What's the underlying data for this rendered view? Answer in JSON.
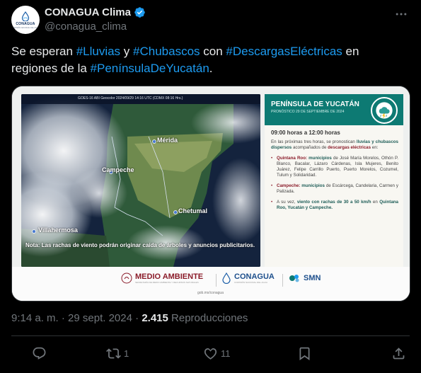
{
  "account": {
    "display_name": "CONAGUA Clima",
    "handle": "@conagua_clima",
    "avatar_text": "CONAGUA",
    "avatar_subtext": "COMISIÓN NACIONAL DEL AGUA"
  },
  "tweet": {
    "parts": [
      {
        "text": "Se esperan ",
        "hashtag": false
      },
      {
        "text": "#Lluvias",
        "hashtag": true
      },
      {
        "text": " y ",
        "hashtag": false
      },
      {
        "text": "#Chubascos",
        "hashtag": true
      },
      {
        "text": " con ",
        "hashtag": false
      },
      {
        "text": "#DescargasEléctricas",
        "hashtag": true
      },
      {
        "text": " en regiones de la ",
        "hashtag": false
      },
      {
        "text": "#PenínsulaDeYucatán",
        "hashtag": true
      },
      {
        "text": ".",
        "hashtag": false
      }
    ]
  },
  "media": {
    "satellite": {
      "header": "GOES-16 ABI Geocolor 2024/09/29 14:16 UTC (CDMX 08:16 Hrs.)",
      "labels": {
        "merida": "Mérida",
        "campeche": "Campeche",
        "chetumal": "Chetumal",
        "villahermosa": "Villahermosa"
      },
      "note": "Nota: Las rachas de viento podrán originar caída de árboles y anuncios publicitarios."
    },
    "panel": {
      "title": "PENÍNSULA DE YUCATÁN",
      "subtitle": "PRONÓSTICO 29 DE SEPTIEMBRE DE 2024",
      "time_range": "09:00 horas a 12:00 horas",
      "intro_1": "En las próximas tres horas, se pronostican ",
      "intro_bold": "lluvias y chubascos dispersos",
      "intro_2": " acompañados de ",
      "intro_red": "descargas eléctricas",
      "intro_3": " en:",
      "qroo_label": "Quintana Roo:",
      "qroo_mun": " municipios",
      "qroo_text": " de José María Morelos, Othón P. Blanco, Bacalar, Lázaro Cárdenas, Isla Mujeres, Benito Juárez, Felipe Carrillo Puerto, Puerto Morelos, Cozumel, Tulum y Solidaridad.",
      "camp_label": "Campeche:",
      "camp_mun": " municipios",
      "camp_text": " de Escárcega, Candelaria, Carmen y Palizada.",
      "wind_1": "A su vez, ",
      "wind_bold": "viento con rachas de 30 a 50 km/h",
      "wind_2": " en ",
      "wind_states": "Quintana Roo, Yucatán y Campeche."
    },
    "footer": {
      "medio_ambiente": "MEDIO AMBIENTE",
      "medio_sub": "SECRETARÍA DE MEDIO AMBIENTE Y RECURSOS NATURALES",
      "conagua": "CONAGUA",
      "conagua_sub": "COMISIÓN NACIONAL DEL AGUA",
      "smn": "SMN",
      "gob_url": "gob.mx/conagua"
    }
  },
  "meta": {
    "time": "9:14 a. m.",
    "date": "29 sept. 2024",
    "views_num": "2.415",
    "views_label": "Reproducciones"
  },
  "actions": {
    "reply_count": "",
    "retweet_count": "1",
    "like_count": "11"
  },
  "colors": {
    "hashtag": "#1d9bf0",
    "verified": "#1d9bf0",
    "panel_accent": "#0d7a73",
    "alert_red": "#8b1c2a"
  }
}
